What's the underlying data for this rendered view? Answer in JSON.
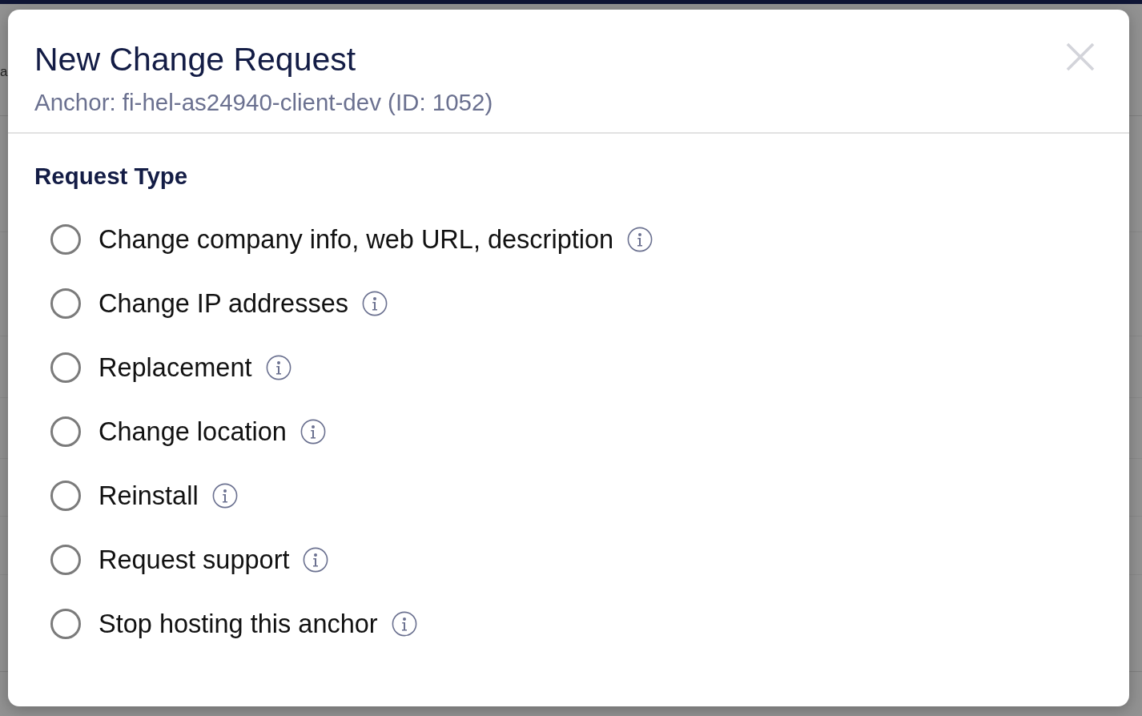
{
  "background": {
    "text_fragment": "a"
  },
  "dialog": {
    "title": "New Change Request",
    "subtitle": "Anchor: fi-hel-as24940-client-dev (ID: 1052)"
  },
  "section": {
    "title": "Request Type",
    "options": [
      {
        "label": "Change company info, web URL, description",
        "selected": false
      },
      {
        "label": "Change IP addresses",
        "selected": false
      },
      {
        "label": "Replacement",
        "selected": false
      },
      {
        "label": "Change location",
        "selected": false
      },
      {
        "label": "Reinstall",
        "selected": false
      },
      {
        "label": "Request support",
        "selected": false
      },
      {
        "label": "Stop hosting this anchor",
        "selected": false
      }
    ]
  }
}
